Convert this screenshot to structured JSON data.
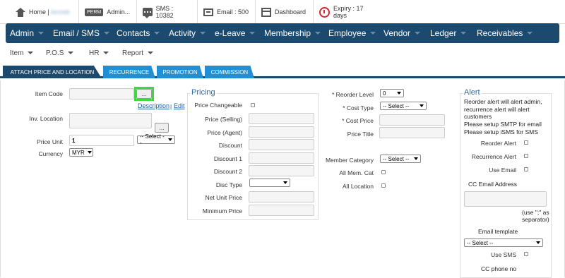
{
  "topbar": {
    "home": "Home |",
    "company": "bestab",
    "perm_badge": "PERM",
    "admin": "Admin...",
    "sms": "SMS : 10382",
    "email": "Email : 500",
    "dashboard": "Dashboard",
    "expiry": "Expiry : 17 days"
  },
  "navbar": [
    {
      "label": "Admin"
    },
    {
      "label": "Email / SMS"
    },
    {
      "label": "Contacts"
    },
    {
      "label": "Activity"
    },
    {
      "label": "e-Leave"
    },
    {
      "label": "Membership"
    },
    {
      "label": "Employee"
    },
    {
      "label": "Vendor"
    },
    {
      "label": "Ledger"
    },
    {
      "label": "Receivables"
    }
  ],
  "subnav": [
    {
      "label": "Item"
    },
    {
      "label": "P.O.S"
    },
    {
      "label": "HR"
    },
    {
      "label": "Report"
    }
  ],
  "tabs": [
    {
      "label": "ATTACH PRICE AND LOCATION"
    },
    {
      "label": "RECURRENCE"
    },
    {
      "label": "PROMOTION"
    },
    {
      "label": "COMMISSION"
    }
  ],
  "left": {
    "item_code_label": "Item Code",
    "browse_btn": "...",
    "description_link": "Description",
    "link_separator": "|",
    "edit_link": "Edit",
    "inv_location_label": "Inv. Location",
    "inv_browse_btn": "...",
    "price_unit_label": "Price Unit",
    "price_unit_value": "1",
    "price_unit_select": "-- Select --",
    "currency_label": "Currency",
    "currency_value": "MYR"
  },
  "pricing": {
    "legend": "Pricing",
    "price_changeable": "Price Changeable",
    "price_selling": "Price (Selling)",
    "price_agent": "Price (Agent)",
    "discount": "Discount",
    "discount1": "Discount 1",
    "discount2": "Discount 2",
    "disc_type": "Disc Type",
    "net_unit_price": "Net Unit Price",
    "minimum_price": "Minimum Price"
  },
  "mid": {
    "reorder_level": "* Reorder Level",
    "reorder_value": "0",
    "cost_type": "* Cost Type",
    "cost_type_select": "-- Select --",
    "cost_price": "* Cost Price",
    "price_title": "Price Title",
    "member_category": "Member Category",
    "member_category_select": "-- Select --",
    "all_mem_cat": "All Mem. Cat",
    "all_location": "All Location"
  },
  "alert": {
    "legend": "Alert",
    "info1": "Reorder alert will alert admin,",
    "info2": "recurrence alert will alert",
    "info3": "customers",
    "info4": "Please setup SMTP for email",
    "info5": "Please setup iSMS for SMS",
    "reorder_alert": "Reorder Alert",
    "recurrence_alert": "Recurrence Alert",
    "use_email": "Use Email",
    "cc_email": "CC Email Address",
    "separator_note1": "(use \";\" as",
    "separator_note2": "separator)",
    "email_template": "Email template",
    "email_template_select": "-- Select --",
    "use_sms": "Use SMS",
    "cc_phone": "CC phone no"
  },
  "colors": {
    "navbar": "#1b4a6e",
    "tab": "#1f8fd6",
    "tab_active": "#1b4a6e",
    "highlight": "#3fd63f",
    "legend": "#2b6ca8",
    "expiry_icon": "#d9232d"
  }
}
